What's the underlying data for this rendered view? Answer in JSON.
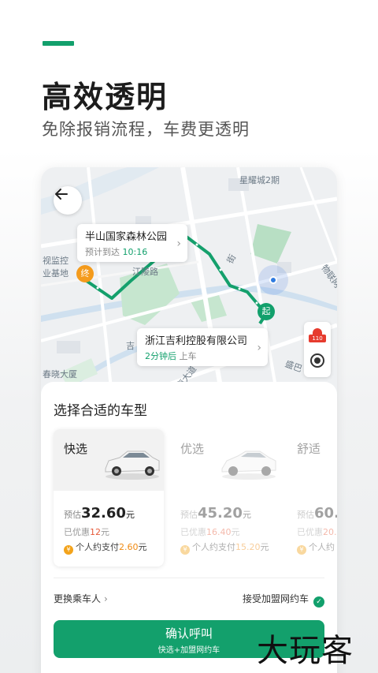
{
  "header": {
    "accent_color": "#12a06c",
    "title": "高效透明",
    "subtitle": "免除报销流程，车费更透明"
  },
  "map": {
    "labels": [
      "星耀城2期",
      "视监控",
      "业基地",
      "江陵路",
      "街",
      "物联网",
      "吉",
      "春晓大厦",
      "南大道",
      "盛巴"
    ],
    "destination": {
      "name": "半山国家森林公园",
      "eta_label": "预计到达",
      "eta_time": "10:16",
      "pin_label": "终"
    },
    "pickup": {
      "name": "浙江吉利控股有限公司",
      "wait": "2分钟后",
      "action": "上车",
      "pin_label": "起"
    },
    "emergency_label": "110",
    "route_color": "#14a06c"
  },
  "panel": {
    "title": "选择合适的车型",
    "cards": [
      {
        "name": "快选",
        "est_label": "预估",
        "price": "32.60",
        "unit": "元",
        "discount_label": "已优惠",
        "discount": "12",
        "discount_unit": "元",
        "pay_label": "个人约支付",
        "pay": "2.60",
        "pay_unit": "元",
        "coin": "¥"
      },
      {
        "name": "优选",
        "est_label": "预估",
        "price": "45.20",
        "unit": "元",
        "discount_label": "已优惠",
        "discount": "16.40",
        "discount_unit": "元",
        "pay_label": "个人约支付",
        "pay": "15.20",
        "pay_unit": "元",
        "coin": "¥"
      },
      {
        "name": "舒适",
        "est_label": "预估",
        "price": "60.",
        "unit": "",
        "discount_label": "已优惠",
        "discount": "20.",
        "discount_unit": "",
        "pay_label": "个人约",
        "pay": "",
        "pay_unit": "",
        "coin": "¥"
      }
    ],
    "change_rider": "更换乘车人",
    "accept_label": "接受加盟网约车",
    "confirm": {
      "label": "确认呼叫",
      "sub": "快选+加盟网约车"
    }
  },
  "watermark": "大玩客"
}
